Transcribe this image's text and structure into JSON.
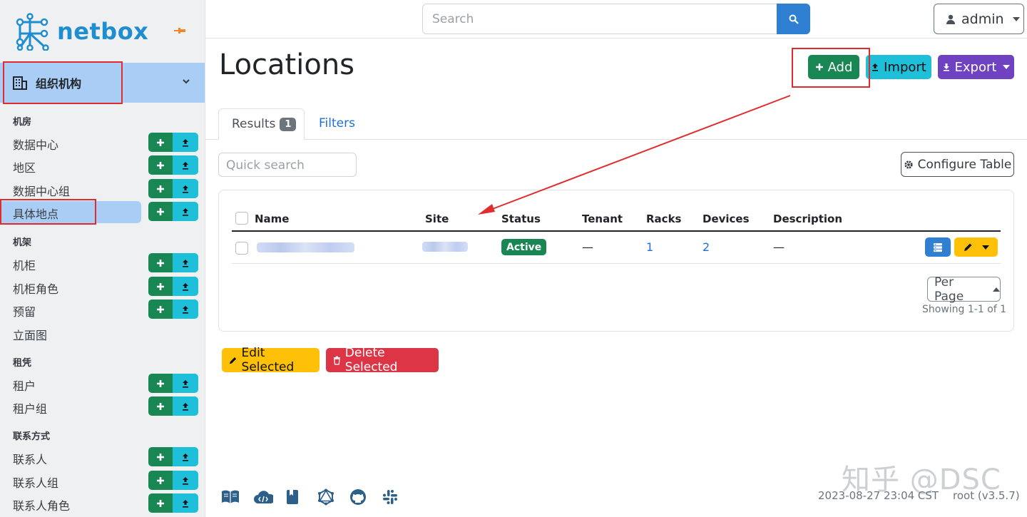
{
  "brand": {
    "name": "netbox"
  },
  "sidebar": {
    "section_title": "组织机构",
    "groups": [
      {
        "label": "机房",
        "items": [
          {
            "label": "数据中心",
            "has_buttons": true
          },
          {
            "label": "地区",
            "has_buttons": true
          },
          {
            "label": "数据中心组",
            "has_buttons": true
          },
          {
            "label": "具体地点",
            "has_buttons": true,
            "active": true
          }
        ]
      },
      {
        "label": "机架",
        "items": [
          {
            "label": "机柜",
            "has_buttons": true
          },
          {
            "label": "机柜角色",
            "has_buttons": true
          },
          {
            "label": "预留",
            "has_buttons": true
          },
          {
            "label": "立面图",
            "has_buttons": false
          }
        ]
      },
      {
        "label": "租凭",
        "items": [
          {
            "label": "租户",
            "has_buttons": true
          },
          {
            "label": "租户组",
            "has_buttons": true
          }
        ]
      },
      {
        "label": "联系方式",
        "items": [
          {
            "label": "联系人",
            "has_buttons": true
          },
          {
            "label": "联系人组",
            "has_buttons": true
          },
          {
            "label": "联系人角色",
            "has_buttons": true
          }
        ]
      }
    ]
  },
  "topbar": {
    "search_placeholder": "Search",
    "user": "admin"
  },
  "page": {
    "title": "Locations",
    "buttons": {
      "add": "Add",
      "import": "Import",
      "export": "Export"
    },
    "tabs": {
      "results": "Results",
      "results_count": "1",
      "filters": "Filters"
    },
    "quick_search_placeholder": "Quick search",
    "configure_table": "Configure Table"
  },
  "table": {
    "columns": [
      "Name",
      "Site",
      "Status",
      "Tenant",
      "Racks",
      "Devices",
      "Description"
    ],
    "rows": [
      {
        "status": "Active",
        "tenant": "—",
        "racks": "1",
        "devices": "2",
        "description": "—"
      }
    ],
    "per_page": "Per Page",
    "showing": "Showing 1-1 of 1"
  },
  "bulk": {
    "edit": "Edit Selected",
    "delete": "Delete Selected"
  },
  "footer": {
    "timestamp": "2023-08-27 23:04 CST",
    "version": "root (v3.5.7)"
  },
  "watermark": "知乎 @DSC",
  "colors": {
    "brand": "#1f8ed1",
    "add": "#198754",
    "import": "#1ebfd8",
    "export": "#6f42c1",
    "primary": "#2f7fd3",
    "warning": "#ffc107",
    "danger": "#dc3545",
    "sidebar_active": "#a9cdf5",
    "annotation": "#e02c2c"
  },
  "icons": [
    "netbox-logo-icon",
    "pin-icon",
    "building-icon",
    "chevron-down-icon",
    "plus-icon",
    "upload-icon",
    "search-icon",
    "user-icon",
    "download-icon",
    "gear-icon",
    "table-icon",
    "pencil-icon",
    "trash-icon",
    "book-icon",
    "cloud-icon",
    "bookmark-icon",
    "graphql-icon",
    "github-icon",
    "slack-icon"
  ]
}
